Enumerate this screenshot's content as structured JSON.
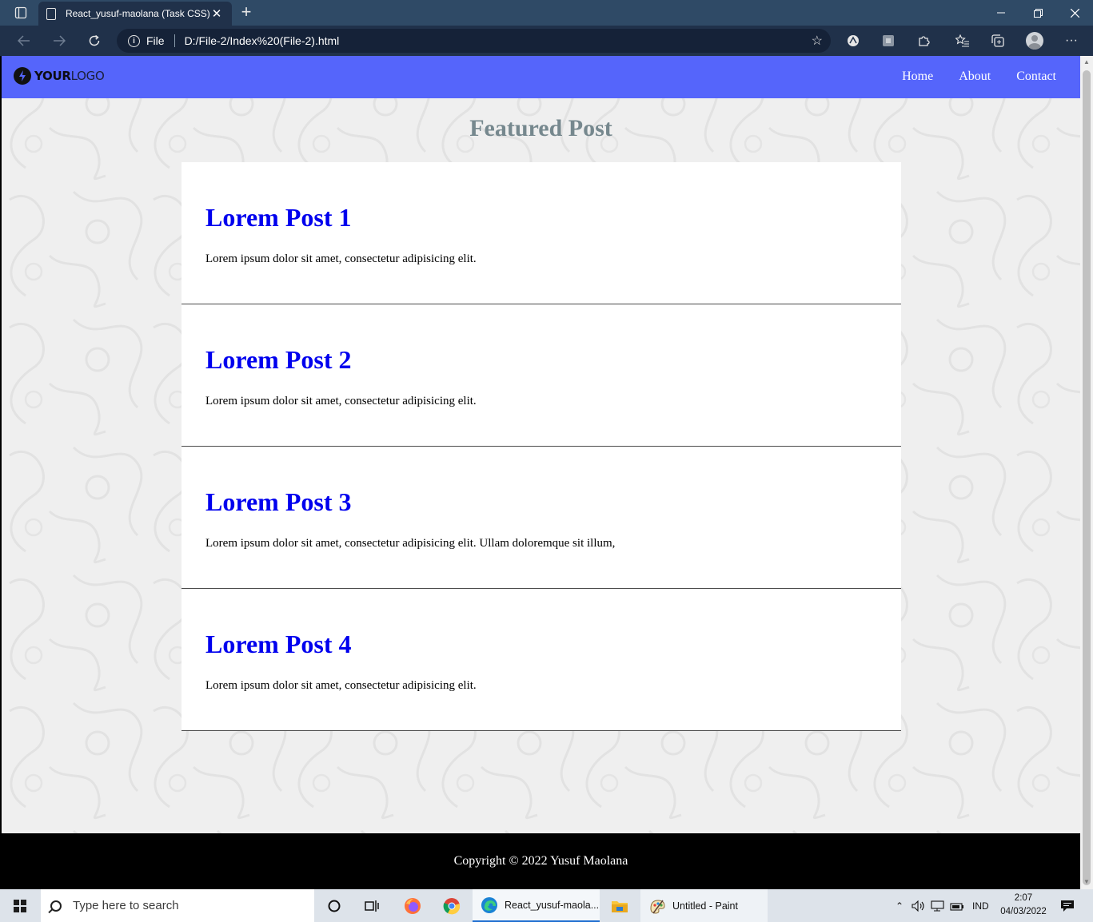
{
  "browser": {
    "tab_title": "React_yusuf-maolana (Task CSS)",
    "url_scheme": "File",
    "url": "D:/File-2/Index%20(File-2).html"
  },
  "site": {
    "logo_bold": "YOUR",
    "logo_light": "LOGO",
    "nav": [
      "Home",
      "About",
      "Contact"
    ],
    "section_title": "Featured Post",
    "posts": [
      {
        "title": "Lorem Post 1",
        "body": "Lorem ipsum dolor sit amet, consectetur adipisicing elit."
      },
      {
        "title": "Lorem Post 2",
        "body": "Lorem ipsum dolor sit amet, consectetur adipisicing elit."
      },
      {
        "title": "Lorem Post 3",
        "body": "Lorem ipsum dolor sit amet, consectetur adipisicing elit. Ullam doloremque sit illum,"
      },
      {
        "title": "Lorem Post 4",
        "body": "Lorem ipsum dolor sit amet, consectetur adipisicing elit."
      }
    ],
    "copyright": "Copyright © 2022 Yusuf Maolana"
  },
  "taskbar": {
    "search_placeholder": "Type here to search",
    "apps": [
      {
        "label": "React_yusuf-maola...",
        "icon": "edge-icon"
      },
      {
        "label": "Untitled - Paint",
        "icon": "paint-icon"
      }
    ],
    "language": "IND",
    "time": "2:07",
    "date": "04/03/2022"
  },
  "colors": {
    "nav_bg": "#5565fb",
    "post_title": "#0000ee",
    "section_title": "#76888e",
    "titlebar": "#2f4a66",
    "addressbar": "#20314a"
  }
}
